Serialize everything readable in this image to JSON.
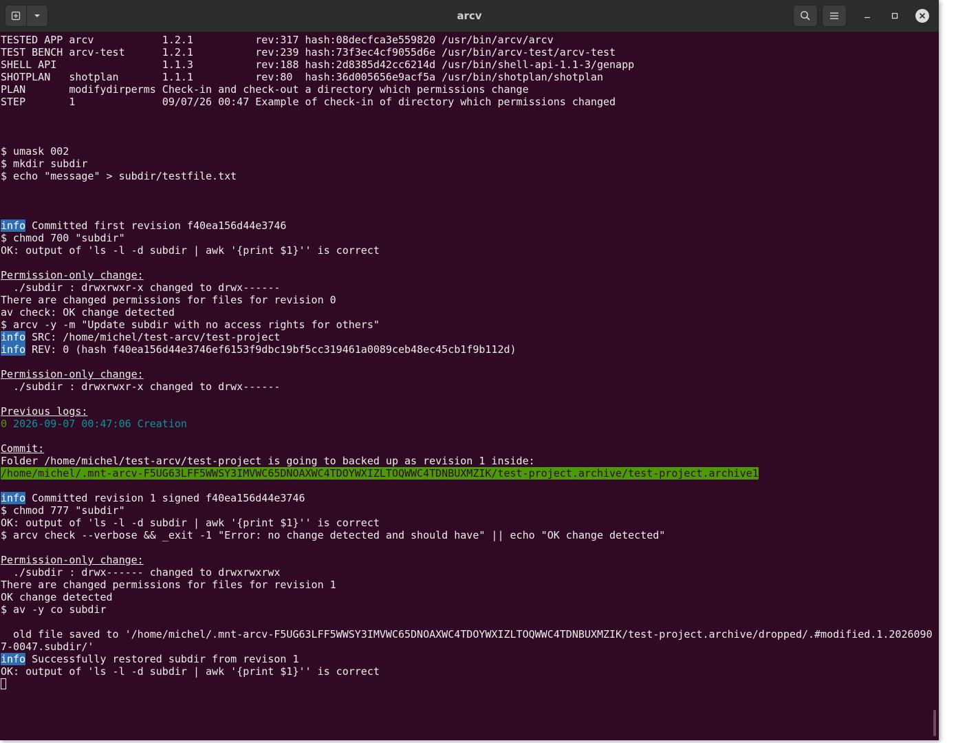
{
  "window": {
    "title": "arcv"
  },
  "toolbar": {
    "new_tab_icon": "new-tab-icon",
    "tab_menu_icon": "chevron-down-icon",
    "search_icon": "search-icon",
    "menu_icon": "hamburger-menu-icon",
    "minimize_icon": "minimize-icon",
    "maximize_icon": "maximize-icon",
    "close_icon": "close-icon"
  },
  "colors": {
    "terminal_bg": "#300a24",
    "text": "#eeeeec",
    "info_tag_bg": "#2f6db3",
    "highlight_bg": "#4e9a06",
    "log_cyan": "#06989a",
    "log_green": "#4e9a06"
  },
  "terminal": {
    "header": [
      "TESTED APP arcv           1.2.1          rev:317 hash:08decfca3e559820 /usr/bin/arcv/arcv",
      "TEST BENCH arcv-test      1.2.1          rev:239 hash:73f3ec4cf9055d6e /usr/bin/arcv-test/arcv-test",
      "SHELL API                 1.1.3          rev:188 hash:2d8385d42cc6214d /usr/bin/shell-api-1.1-3/genapp",
      "SHOTPLAN   shotplan       1.1.1          rev:80  hash:36d005656e9acf5a /usr/bin/shotplan/shotplan",
      "PLAN       modifydirperms Check-in and check-out a directory which permissions change",
      "STEP       1              09/07/26 00:47 Example of check-in of directory which permissions changed"
    ],
    "setup": [
      "$ umask 002",
      "$ mkdir subdir",
      "$ echo \"message\" > subdir/testfile.txt"
    ],
    "info_tag": "info",
    "l_commit_first": " Committed first revision f40ea156d44e3746",
    "l_chmod700": "$ chmod 700 \"subdir\"",
    "l_ok_ls": "OK: output of 'ls -l -d subdir | awk '{print $1}'' is correct",
    "perm_heading": "Permission-only change:",
    "l_perm1": "  ./subdir : drwxrwxr-x changed to drwx------",
    "l_changed0": "There are changed permissions for files for revision 0",
    "l_avcheck": "av check: OK change detected",
    "l_arcv_commit": "$ arcv -y -m \"Update subdir with no access rights for others\"",
    "l_src": " SRC: /home/michel/test-arcv/test-project",
    "l_rev": " REV: 0 (hash f40ea156d44e3746ef6153f9dbc19bf5cc319461a0089ceb48ec45cb1f9b112d)",
    "prev_logs_heading": "Previous logs:",
    "log_num": "0",
    "log_text": " 2026-09-07 00:47:06 Creation",
    "commit_heading": "Commit:",
    "l_folder": "Folder /home/michel/test-arcv/test-project is going to backed up as revision 1 inside:",
    "l_archive_path": "/home/michel/.mnt-arcv-F5UG63LFF5WWSY3IMVWC65DNOAXWC4TDOYWXIZLTOQWWC4TDNBUXMZIK/test-project.archive/test-project.archive1",
    "l_committed1": " Committed revision 1 signed f40ea156d44e3746",
    "l_chmod777": "$ chmod 777 \"subdir\"",
    "l_arcv_check": "$ arcv check --verbose && _exit -1 \"Error: no change detected and should have\" || echo \"OK change detected\"",
    "l_perm2": "  ./subdir : drwx------ changed to drwxrwxrwx",
    "l_changed1": "There are changed permissions for files for revision 1",
    "l_ok_change": "OK change detected",
    "l_co": "$ av -y co subdir",
    "l_saved1": "  old file saved to '/home/michel/.mnt-arcv-F5UG63LFF5WWSY3IMVWC65DNOAXWC4TDOYWXIZLTOQWWC4TDNBUXMZIK/test-project.archive/dropped/.#modified.1.2026090",
    "l_saved2": "7-0047.subdir/'",
    "l_restored": " Successfully restored subdir from revison 1"
  }
}
